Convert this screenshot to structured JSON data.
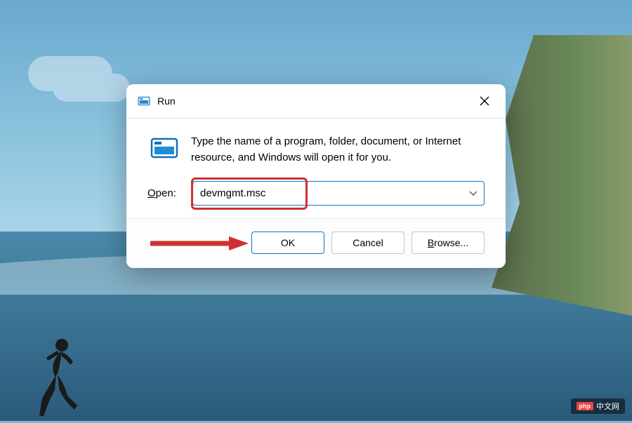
{
  "dialog": {
    "title": "Run",
    "info_text": "Type the name of a program, folder, document, or Internet resource, and Windows will open it for you.",
    "open_label_prefix": "O",
    "open_label_rest": "pen:",
    "input_value": "devmgmt.msc",
    "buttons": {
      "ok": "OK",
      "cancel": "Cancel",
      "browse_prefix": "B",
      "browse_rest": "rowse..."
    }
  },
  "annotations": {
    "highlight_color": "#d03030",
    "arrow_color": "#d03030"
  },
  "watermark": {
    "badge": "php",
    "text": "中文网"
  }
}
